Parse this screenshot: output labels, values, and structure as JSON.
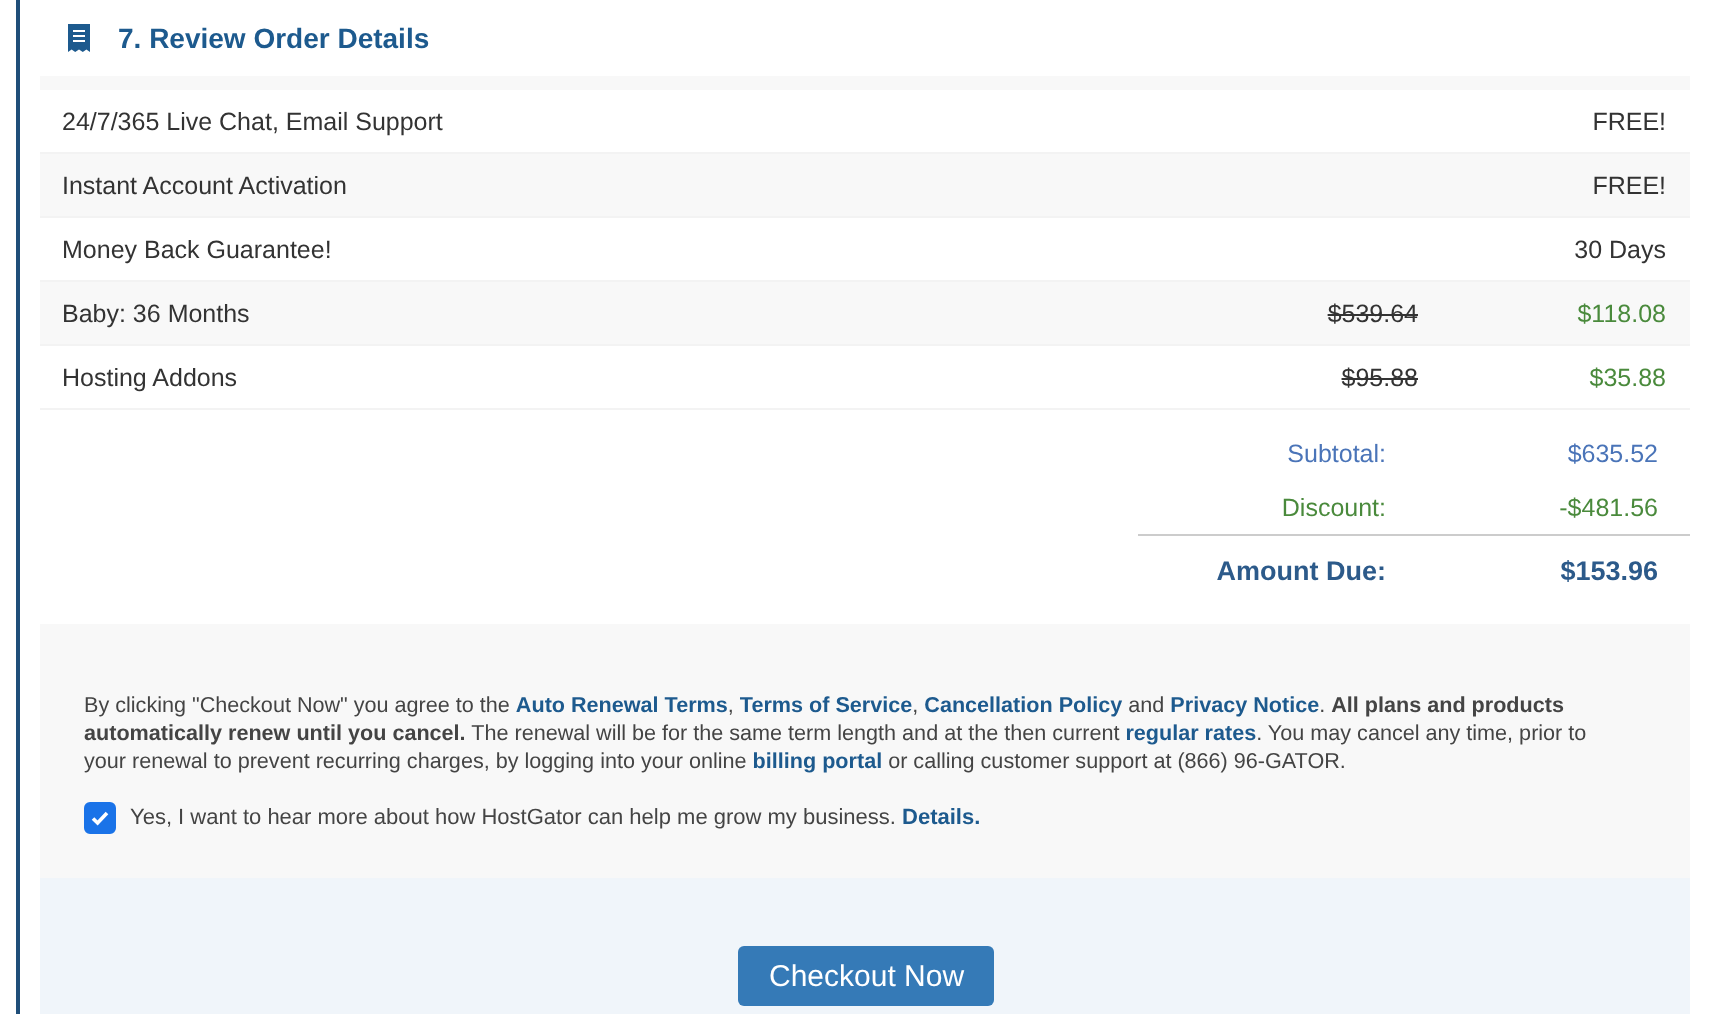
{
  "section": {
    "title": "7. Review Order Details"
  },
  "items": [
    {
      "label": "24/7/365 Live Chat, Email Support",
      "price": "FREE!",
      "kind": "plain"
    },
    {
      "label": "Instant Account Activation",
      "price": "FREE!",
      "kind": "plain"
    },
    {
      "label": "Money Back Guarantee!",
      "price": "30 Days",
      "kind": "plain"
    },
    {
      "label": "Baby: 36 Months",
      "original_price": "$539.64",
      "price": "$118.08",
      "kind": "discounted"
    },
    {
      "label": "Hosting Addons",
      "original_price": "$95.88",
      "price": "$35.88",
      "kind": "discounted"
    }
  ],
  "totals": [
    {
      "label": "Subtotal:",
      "value": "$635.52",
      "kind": "subtotal"
    },
    {
      "label": "Discount:",
      "value": "-$481.56",
      "kind": "discount"
    },
    {
      "label": "Amount Due:",
      "value": "$153.96",
      "kind": "due"
    }
  ],
  "terms": [
    {
      "kind": "text",
      "text": "By clicking \"Checkout Now\" you agree to the "
    },
    {
      "kind": "link",
      "text": "Auto Renewal Terms"
    },
    {
      "kind": "text",
      "text": ", "
    },
    {
      "kind": "link",
      "text": "Terms of Service"
    },
    {
      "kind": "text",
      "text": ", "
    },
    {
      "kind": "link",
      "text": "Cancellation Policy"
    },
    {
      "kind": "text",
      "text": " and "
    },
    {
      "kind": "link",
      "text": "Privacy Notice"
    },
    {
      "kind": "text",
      "text": ". "
    },
    {
      "kind": "bold",
      "text": "All plans and products automatically renew until you cancel."
    },
    {
      "kind": "text",
      "text": " The renewal will be for the same term length and at the then current "
    },
    {
      "kind": "link",
      "text": "regular rates"
    },
    {
      "kind": "text",
      "text": ". You may cancel any time, prior to your renewal to prevent recurring charges, by logging into your online "
    },
    {
      "kind": "link",
      "text": "billing portal"
    },
    {
      "kind": "text",
      "text": " or calling customer support at (866) 96-GATOR."
    }
  ],
  "opt_in": {
    "checked": true,
    "text": "Yes, I want to hear more about how HostGator can help me grow my business.",
    "link": "Details."
  },
  "checkout_button": "Checkout Now"
}
